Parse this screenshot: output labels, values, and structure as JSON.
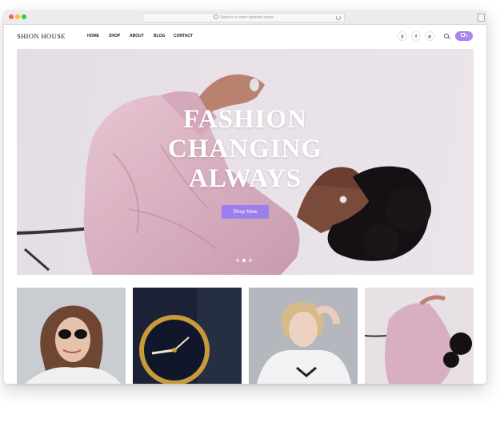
{
  "browser": {
    "url_placeholder": "Search or enter website name"
  },
  "header": {
    "logo": "SHION HOUSE",
    "nav": [
      "HOME",
      "SHOP",
      "ABOUT",
      "BLOG",
      "CONTACT"
    ],
    "social": [
      "twitter-icon",
      "facebook-icon",
      "pinterest-icon"
    ],
    "social_glyphs": [
      "ẏ",
      "f",
      "p"
    ],
    "cart_count": "0"
  },
  "hero": {
    "title_lines": [
      "FASHION",
      "CHANGING",
      "ALWAYS"
    ],
    "button_label": "Shop Now",
    "slides": 3,
    "active_slide": 2
  },
  "products": [
    {
      "name": "sunglasses-woman"
    },
    {
      "name": "wrist-watch"
    },
    {
      "name": "hoodie-woman"
    },
    {
      "name": "pink-shirt-woman"
    }
  ],
  "colors": {
    "accent": "#9d7fec",
    "hero_bg": "#e6e0e7",
    "shirt": "#d9b3c2"
  }
}
